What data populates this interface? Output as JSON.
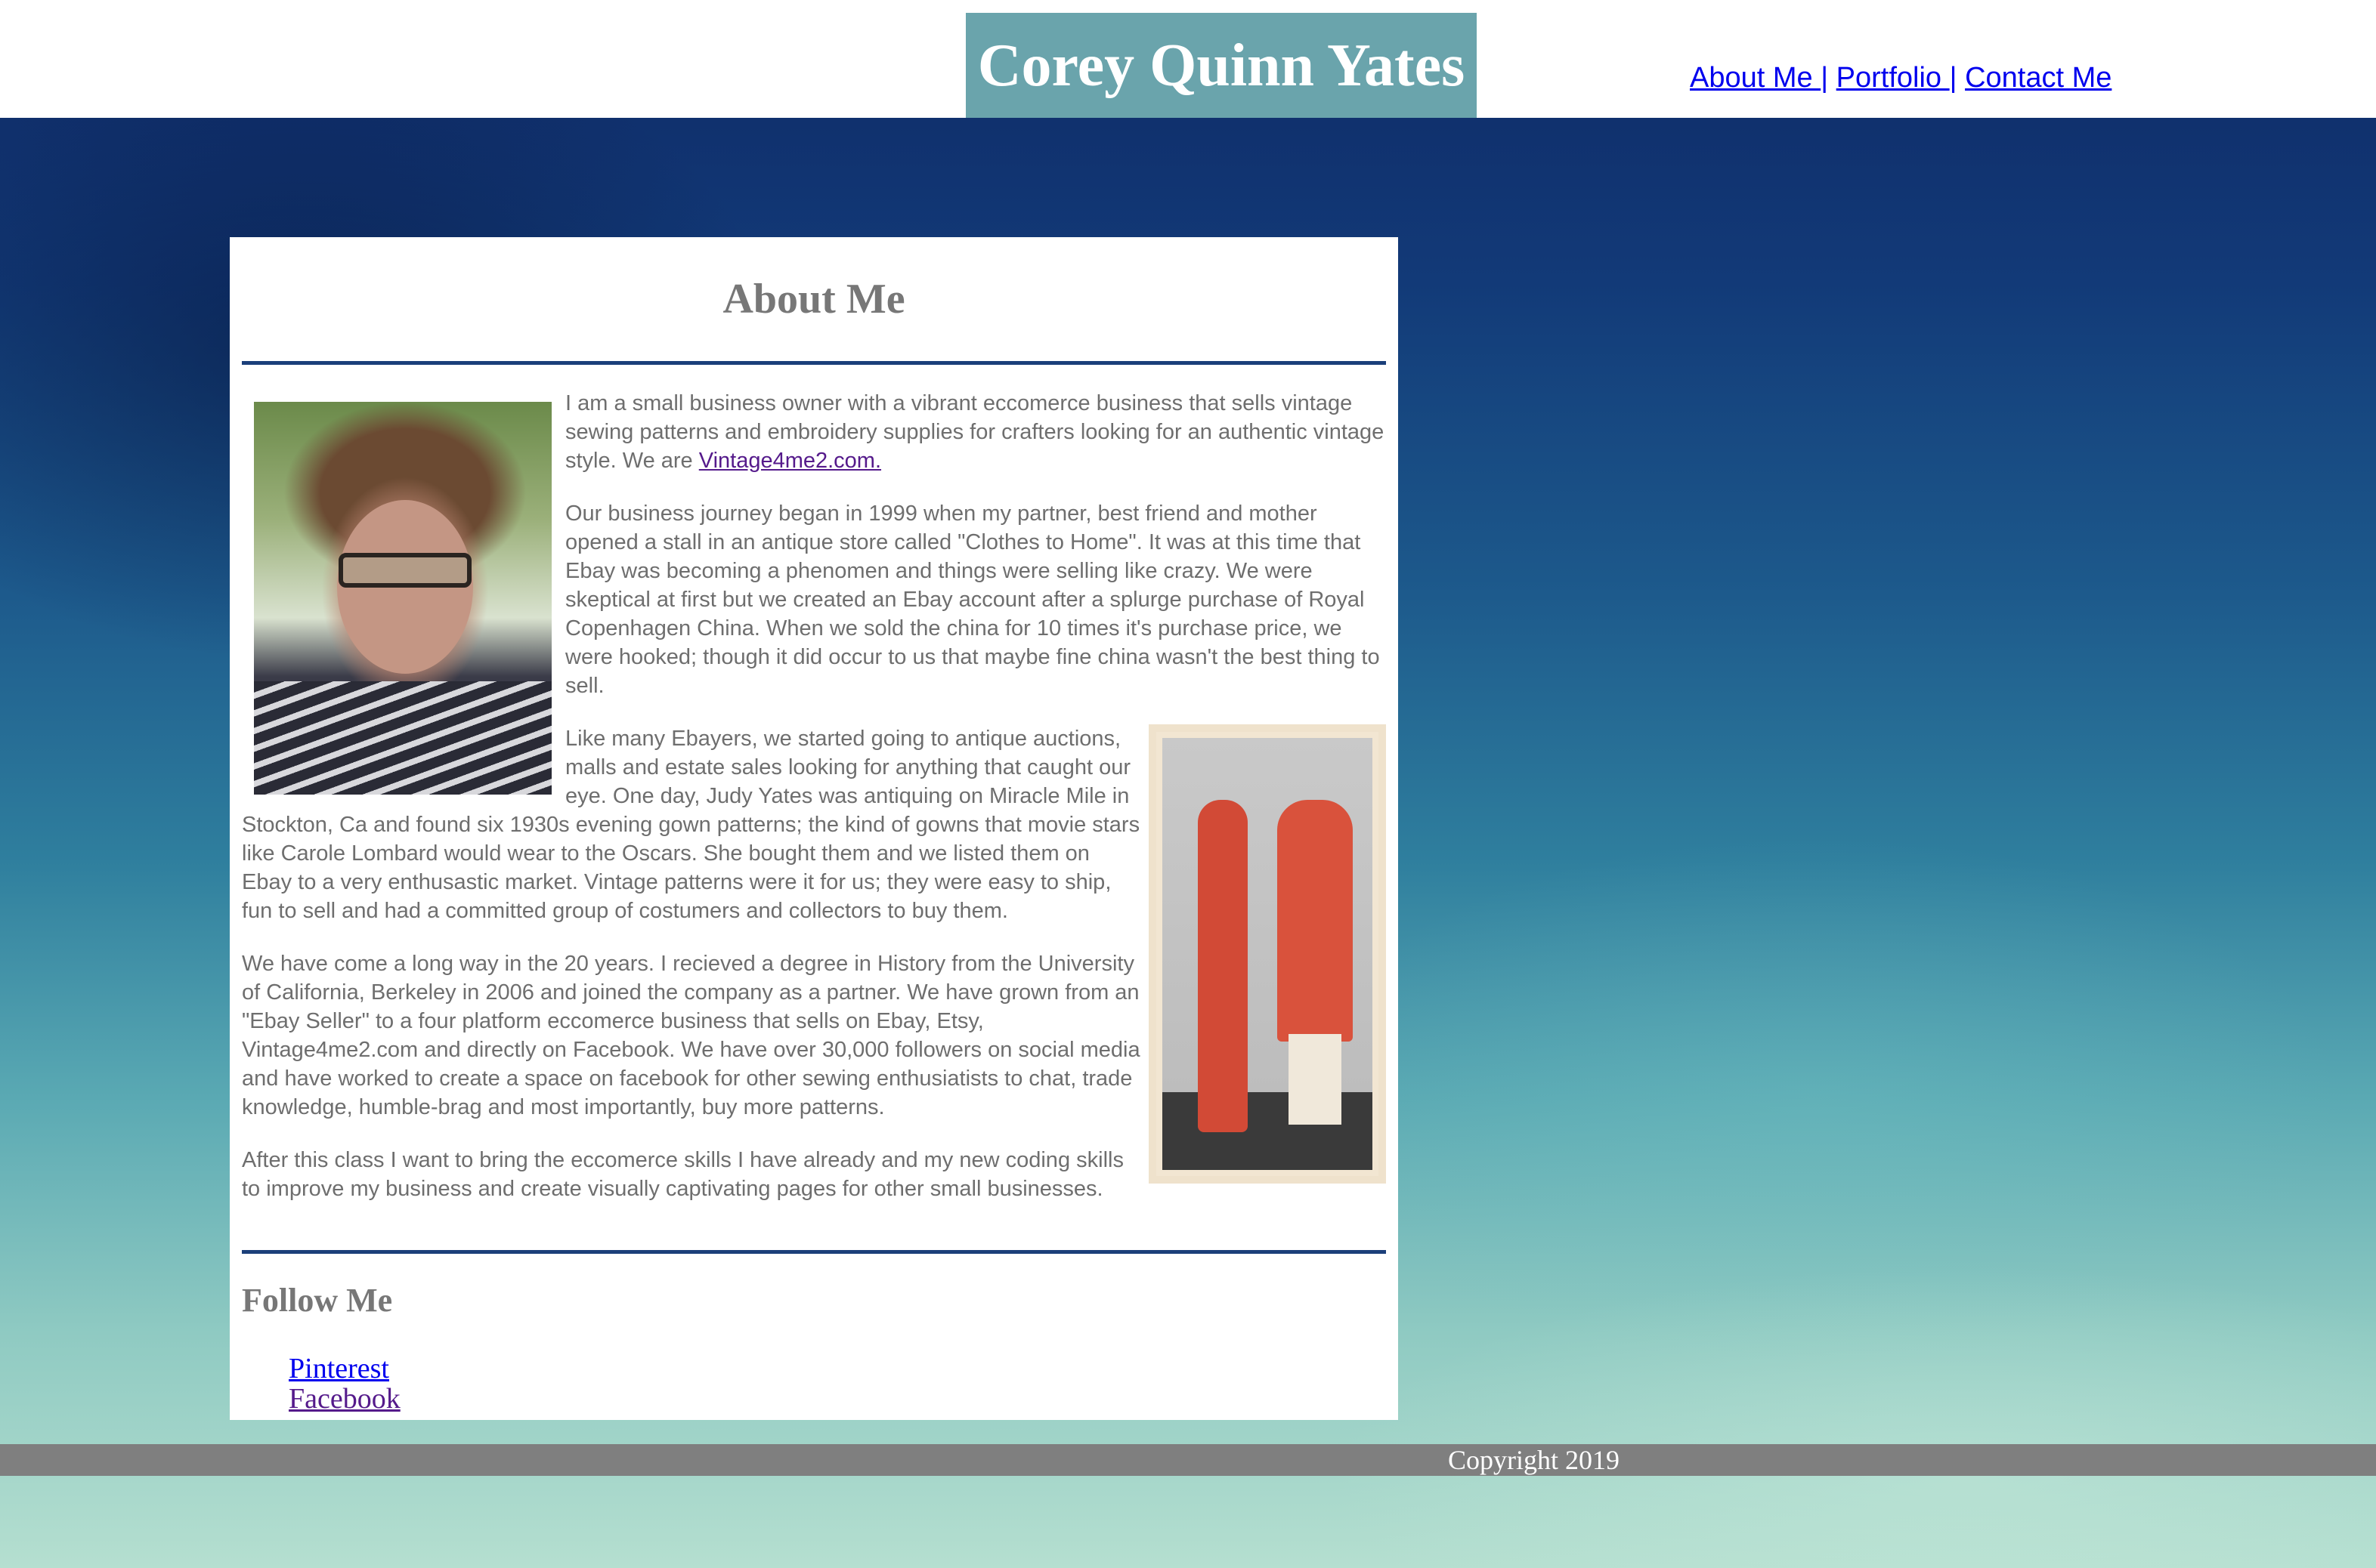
{
  "header": {
    "site_title": "Corey Quinn Yates",
    "nav": {
      "about": "About Me ",
      "portfolio": "Portfolio ",
      "contact": "Contact Me",
      "separator": "|"
    }
  },
  "about": {
    "heading": "About Me",
    "p1_text": "I am a small business owner with a vibrant eccomerce business that sells vintage sewing patterns and embroidery supplies for crafters looking for an authentic vintage style. We are ",
    "p1_link": "Vintage4me2.com.",
    "p2": "Our business journey began in 1999 when my partner, best friend and mother opened a stall in an antique store called \"Clothes to Home\". It was at this time that Ebay was becoming a phenomen and things were selling like crazy. We were skeptical at first but we created an Ebay account after a splurge purchase of Royal Copenhagen China. When we sold the china for 10 times it's purchase price, we were hooked; though it did occur to us that maybe fine china wasn't the best thing to sell.",
    "p3": "Like many Ebayers, we started going to antique auctions, malls and estate sales looking for anything that caught our eye. One day, Judy Yates was antiquing on Miracle Mile in Stockton, Ca and found six 1930s evening gown patterns; the kind of gowns that movie stars like Carole Lombard would wear to the Oscars. She bought them and we listed them on Ebay to a very enthusastic market. Vintage patterns were it for us; they were easy to ship, fun to sell and had a committed group of costumers and collectors to buy them.",
    "p4": "We have come a long way in the 20 years. I recieved a degree in History from the University of California, Berkeley in 2006 and joined the company as a partner. We have grown from an \"Ebay Seller\" to a four platform eccomerce business that sells on Ebay, Etsy, Vintage4me2.com and directly on Facebook. We have over 30,000 followers on social media and have worked to create a space on facebook for other sewing enthusiatists to chat, trade knowledge, humble-brag and most importantly, buy more patterns.",
    "p5": "After this class I want to bring the eccomerce skills I have already and my new coding skills to improve my business and create visually captivating pages for other small businesses."
  },
  "follow": {
    "heading": "Follow Me",
    "links": [
      "Pinterest",
      "Facebook"
    ]
  },
  "footer": {
    "copyright": "Copyright 2019"
  },
  "colors": {
    "title_bg": "#6aa4ac",
    "rule": "#1b3f7a",
    "link": "#0000ee",
    "visited": "#551a8b",
    "footer_bar": "#7f7f7f"
  }
}
